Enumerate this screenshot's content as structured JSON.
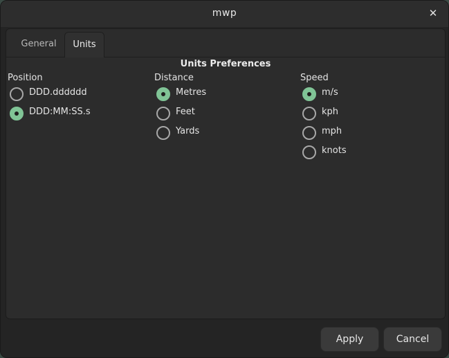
{
  "window": {
    "title": "mwp",
    "close_glyph": "✕"
  },
  "tabs": [
    {
      "label": "General",
      "selected": false
    },
    {
      "label": "Units",
      "selected": true
    }
  ],
  "panel": {
    "title": "Units Preferences"
  },
  "position": {
    "label": "Position",
    "options": [
      {
        "label": "DDD.dddddd",
        "checked": false
      },
      {
        "label": "DDD:MM:SS.s",
        "checked": true
      }
    ]
  },
  "distance": {
    "label": "Distance",
    "options": [
      {
        "label": "Metres",
        "checked": true
      },
      {
        "label": "Feet",
        "checked": false
      },
      {
        "label": "Yards",
        "checked": false
      }
    ]
  },
  "speed": {
    "label": "Speed",
    "options": [
      {
        "label": "m/s",
        "checked": true
      },
      {
        "label": "kph",
        "checked": false
      },
      {
        "label": "mph",
        "checked": false
      },
      {
        "label": "knots",
        "checked": false
      }
    ]
  },
  "buttons": {
    "apply_label": "Apply",
    "cancel_label": "Cancel"
  },
  "colors": {
    "accent": "#80c496",
    "background": "#242424"
  }
}
